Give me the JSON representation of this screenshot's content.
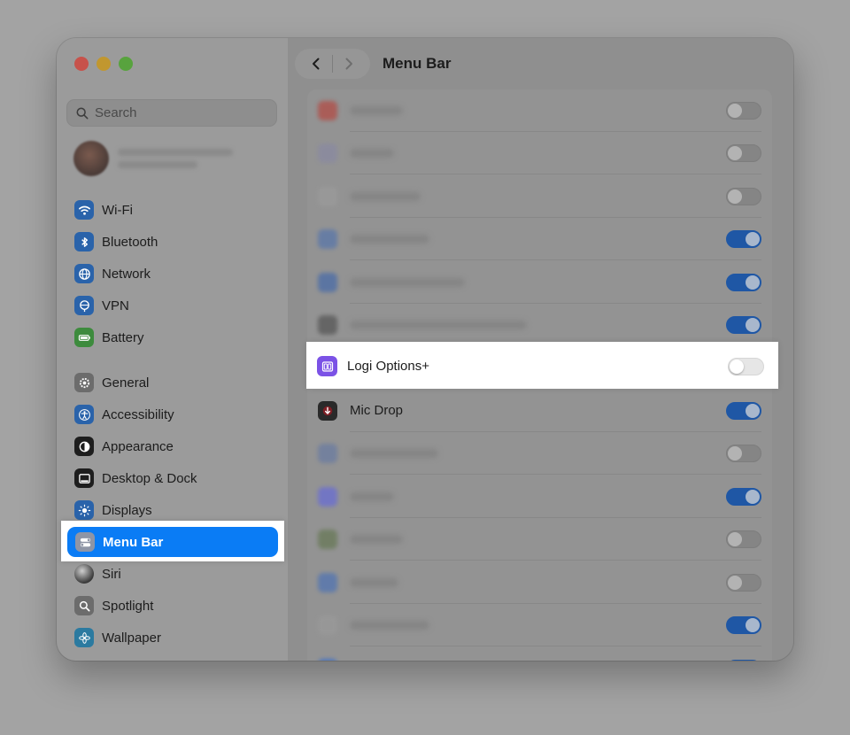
{
  "window": {
    "title": "Menu Bar"
  },
  "sidebar": {
    "search_placeholder": "Search",
    "items": [
      {
        "label": "Wi-Fi",
        "icon": "wifi-icon",
        "color": "#2a63aa"
      },
      {
        "label": "Bluetooth",
        "icon": "bluetooth-icon",
        "color": "#2a63aa"
      },
      {
        "label": "Network",
        "icon": "globe-icon",
        "color": "#2a63aa"
      },
      {
        "label": "VPN",
        "icon": "vpn-icon",
        "color": "#2a63aa"
      },
      {
        "label": "Battery",
        "icon": "battery-icon",
        "color": "#3d8b3d"
      },
      {
        "label": "General",
        "icon": "gear-icon",
        "color": "#6c6c6c"
      },
      {
        "label": "Accessibility",
        "icon": "accessibility-icon",
        "color": "#2a63aa"
      },
      {
        "label": "Appearance",
        "icon": "appearance-icon",
        "color": "#1e1e1e"
      },
      {
        "label": "Desktop & Dock",
        "icon": "dock-icon",
        "color": "#1e1e1e"
      },
      {
        "label": "Displays",
        "icon": "sun-icon",
        "color": "#2a63aa"
      },
      {
        "label": "Menu Bar",
        "icon": "menubar-toggle-icon",
        "color": "#8e95a6",
        "selected": true
      },
      {
        "label": "Siri",
        "icon": "siri-icon",
        "color": "#1e1e1e"
      },
      {
        "label": "Spotlight",
        "icon": "magnifier-icon",
        "color": "#6c6c6c"
      },
      {
        "label": "Wallpaper",
        "icon": "flower-icon",
        "color": "#2b7aa0"
      }
    ]
  },
  "main": {
    "rows": [
      {
        "label": "Logi Options+",
        "toggle_on": false,
        "icon": "logi-options-icon",
        "highlighted": true
      },
      {
        "label": "Mic Drop",
        "toggle_on": true,
        "icon": "mic-drop-icon"
      }
    ],
    "blurred_toggles": [
      false,
      false,
      false,
      true,
      true,
      true,
      null,
      null,
      false,
      true,
      false,
      false,
      true,
      true
    ]
  },
  "colors": {
    "accent": "#0a7cf5",
    "toggle_on": "#1f57a5"
  }
}
